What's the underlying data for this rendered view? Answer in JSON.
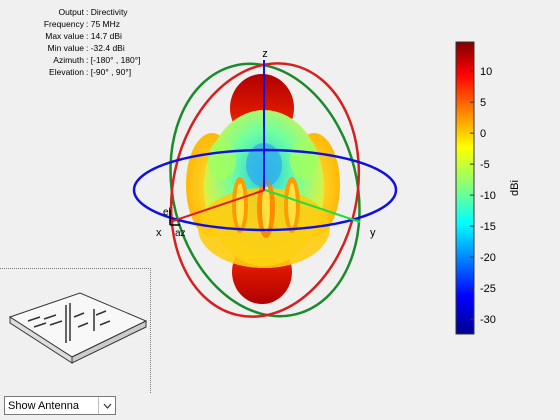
{
  "info": [
    {
      "label": "Output",
      "value": ": Directivity"
    },
    {
      "label": "Frequency",
      "value": ": 75 MHz"
    },
    {
      "label": "Max value",
      "value": ": 14.7 dBi"
    },
    {
      "label": "Min value",
      "value": ": -32.4 dBi"
    },
    {
      "label": "Azimuth",
      "value": ": [-180° , 180°]"
    },
    {
      "label": "Elevation",
      "value": ": [-90° , 90°]"
    }
  ],
  "axes": {
    "x": "x",
    "y": "y",
    "z": "z",
    "az": "az",
    "el": "el"
  },
  "colorbar": {
    "label": "dBi",
    "ticks": [
      "10",
      "5",
      "0",
      "-5",
      "-10",
      "-15",
      "-20",
      "-25",
      "-30"
    ],
    "tick_values": [
      10,
      5,
      0,
      -5,
      -10,
      -15,
      -20,
      -25,
      -30
    ],
    "min": -32.4,
    "max": 14.7
  },
  "control": {
    "selected": "Show Antenna"
  },
  "colors": {
    "x_circle": "#d62020",
    "y_circle": "#1a8a2a",
    "z_circle": "#1010e0"
  }
}
